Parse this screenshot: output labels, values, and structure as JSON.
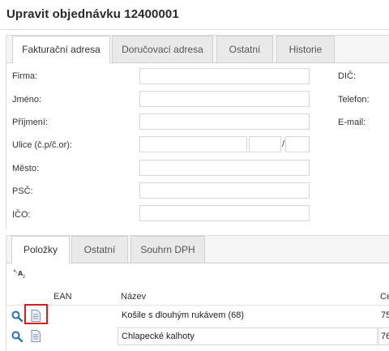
{
  "page": {
    "title": "Upravit objednávku 12400001"
  },
  "address_tabs": [
    {
      "label": "Fakturační adresa",
      "active": true
    },
    {
      "label": "Doručovací adresa",
      "active": false
    },
    {
      "label": "Ostatní",
      "active": false
    },
    {
      "label": "Historie",
      "active": false
    }
  ],
  "form": {
    "firma_label": "Firma:",
    "jmeno_label": "Jméno:",
    "prijmeni_label": "Příjmení:",
    "ulice_label": "Ulice (č.p/č.or):",
    "ulice_separator": "/",
    "mesto_label": "Město:",
    "psc_label": "PSČ:",
    "ico_label": "IČO:",
    "dic_label": "DIČ:",
    "telefon_label": "Telefon:",
    "email_label": "E-mail:",
    "firma_value": "",
    "jmeno_value": "",
    "prijmeni_value": "",
    "ulice_value": "",
    "cp_value": "",
    "cor_value": "",
    "mesto_value": "",
    "psc_value": "",
    "ico_value": ""
  },
  "items_tabs": [
    {
      "label": "Položky",
      "active": true
    },
    {
      "label": "Ostatní",
      "active": false
    },
    {
      "label": "Souhrn DPH",
      "active": false
    }
  ],
  "grid": {
    "columns": {
      "ean": "EAN",
      "nazev": "Název",
      "cena": "Ce"
    },
    "rows": [
      {
        "ean": "",
        "nazev": "Košile s dlouhým rukávem (68)",
        "cena": "75"
      },
      {
        "ean": "",
        "nazev": "Chlapecké kalhoty",
        "cena": "76"
      }
    ]
  },
  "icons": {
    "sort": "sort-az-icon",
    "search": "magnifier-icon",
    "document": "document-icon"
  },
  "colors": {
    "highlight": "#d61f1f",
    "search_icon": "#2a6fb5"
  }
}
